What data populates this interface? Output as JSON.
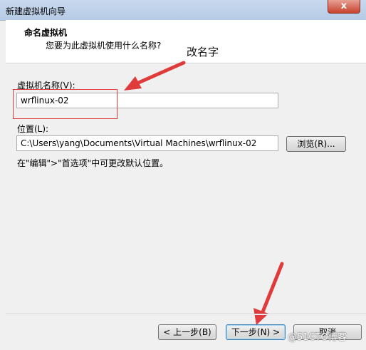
{
  "window": {
    "title": "新建虚拟机向导",
    "close_label": "x"
  },
  "header": {
    "title": "命名虚拟机",
    "subtitle": "您要为此虚拟机使用什么名称?"
  },
  "annotation": {
    "text": "改名字",
    "color": "#e03b3b"
  },
  "form": {
    "name_label": "虚拟机名称(V):",
    "name_value": "wrflinux-02",
    "location_label": "位置(L):",
    "location_value": "C:\\Users\\yang\\Documents\\Virtual Machines\\wrflinux-02",
    "browse_label": "浏览(R)...",
    "hint": "在\"编辑\">\"首选项\"中可更改默认位置。"
  },
  "footer": {
    "back_label": "< 上一步(B)",
    "next_label": "下一步(N) >",
    "cancel_label": "取消"
  },
  "watermark": "@51CTO博客"
}
